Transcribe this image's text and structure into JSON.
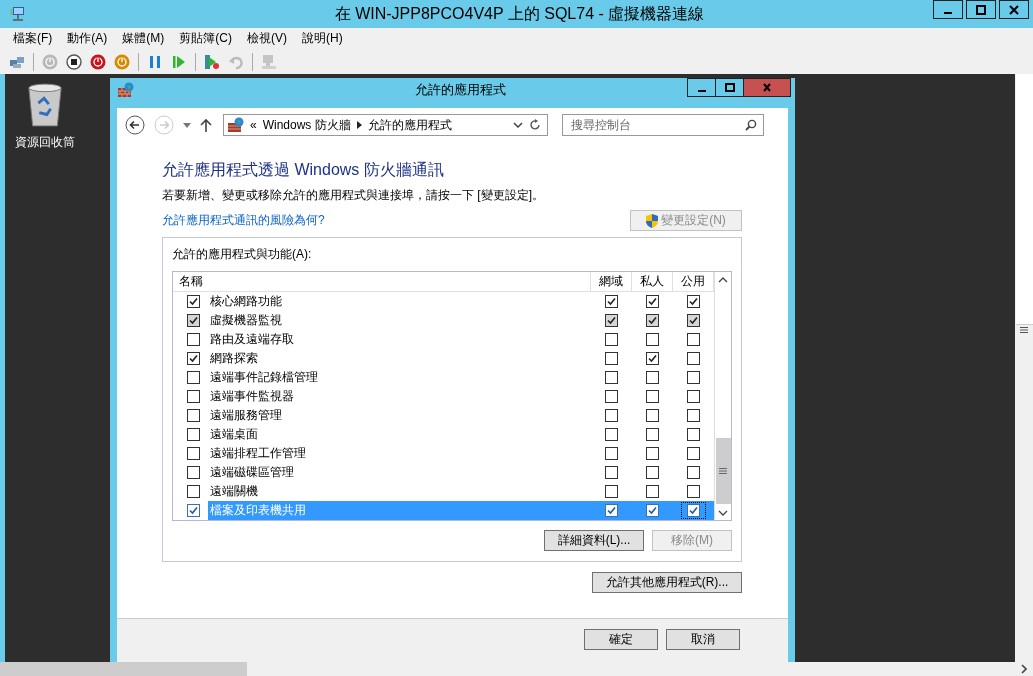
{
  "window": {
    "title": "在 WIN-JPP8PCO4V4P 上的 SQL74 - 虛擬機器連線"
  },
  "menu": [
    "檔案(F)",
    "動作(A)",
    "媒體(M)",
    "剪貼簿(C)",
    "檢視(V)",
    "說明(H)"
  ],
  "toolbar_groups": [
    {
      "items": [
        {
          "kind": "ctrl-alt-del",
          "disabled": false
        }
      ]
    },
    {
      "items": [
        {
          "kind": "start",
          "disabled": true
        },
        {
          "kind": "turn-off",
          "disabled": false
        },
        {
          "kind": "shutdown",
          "disabled": false
        },
        {
          "kind": "save",
          "disabled": false
        }
      ]
    },
    {
      "items": [
        {
          "kind": "pause",
          "disabled": false
        },
        {
          "kind": "resume",
          "disabled": false
        }
      ]
    },
    {
      "items": [
        {
          "kind": "checkpoint",
          "disabled": false
        },
        {
          "kind": "revert",
          "disabled": true
        }
      ]
    },
    {
      "items": [
        {
          "kind": "enhanced",
          "disabled": true
        }
      ]
    }
  ],
  "desktop_icons": [
    {
      "label": "資源回收筒"
    }
  ],
  "dialog": {
    "title": "允許的應用程式",
    "breadcrumb": [
      "«",
      "Windows 防火牆",
      "允許的應用程式"
    ],
    "search": {
      "placeholder": "搜尋控制台"
    },
    "heading": "允許應用程式透過 Windows 防火牆通訊",
    "description": "若要新增、變更或移除允許的應用程式與連接埠，請按一下 [變更設定]。",
    "link": "允許應用程式通訊的風險為何?",
    "change_settings": {
      "label": "變更設定(N)",
      "disabled": true
    },
    "group_label": "允許的應用程式與功能(A):",
    "columns": [
      "名稱",
      "網域",
      "私人",
      "公用"
    ],
    "rows": [
      {
        "name": "核心網路功能",
        "checked": true,
        "domain": true,
        "private": true,
        "public": true,
        "disabled": false,
        "selected": false,
        "focused": false
      },
      {
        "name": "虛擬機器監視",
        "checked": true,
        "domain": true,
        "private": true,
        "public": true,
        "disabled": true,
        "selected": false,
        "focused": false
      },
      {
        "name": "路由及遠端存取",
        "checked": false,
        "domain": false,
        "private": false,
        "public": false,
        "disabled": false,
        "selected": false,
        "focused": false
      },
      {
        "name": "網路探索",
        "checked": true,
        "domain": false,
        "private": true,
        "public": false,
        "disabled": false,
        "selected": false,
        "focused": false
      },
      {
        "name": "遠端事件記錄檔管理",
        "checked": false,
        "domain": false,
        "private": false,
        "public": false,
        "disabled": false,
        "selected": false,
        "focused": false
      },
      {
        "name": "遠端事件監視器",
        "checked": false,
        "domain": false,
        "private": false,
        "public": false,
        "disabled": false,
        "selected": false,
        "focused": false
      },
      {
        "name": "遠端服務管理",
        "checked": false,
        "domain": false,
        "private": false,
        "public": false,
        "disabled": false,
        "selected": false,
        "focused": false
      },
      {
        "name": "遠端桌面",
        "checked": false,
        "domain": false,
        "private": false,
        "public": false,
        "disabled": false,
        "selected": false,
        "focused": false
      },
      {
        "name": "遠端排程工作管理",
        "checked": false,
        "domain": false,
        "private": false,
        "public": false,
        "disabled": false,
        "selected": false,
        "focused": false
      },
      {
        "name": "遠端磁碟區管理",
        "checked": false,
        "domain": false,
        "private": false,
        "public": false,
        "disabled": false,
        "selected": false,
        "focused": false
      },
      {
        "name": "遠端關機",
        "checked": false,
        "domain": false,
        "private": false,
        "public": false,
        "disabled": false,
        "selected": false,
        "focused": false
      },
      {
        "name": "檔案及印表機共用",
        "checked": true,
        "domain": true,
        "private": true,
        "public": true,
        "disabled": false,
        "selected": true,
        "focused": true
      }
    ],
    "details_button": {
      "label": "詳細資料(L)...",
      "disabled": false
    },
    "remove_button": {
      "label": "移除(M)",
      "disabled": true
    },
    "allow_other_button": {
      "label": "允許其他應用程式(R)...",
      "disabled": false
    },
    "ok_button": {
      "label": "確定",
      "disabled": false
    },
    "cancel_button": {
      "label": "取消",
      "disabled": false
    }
  }
}
